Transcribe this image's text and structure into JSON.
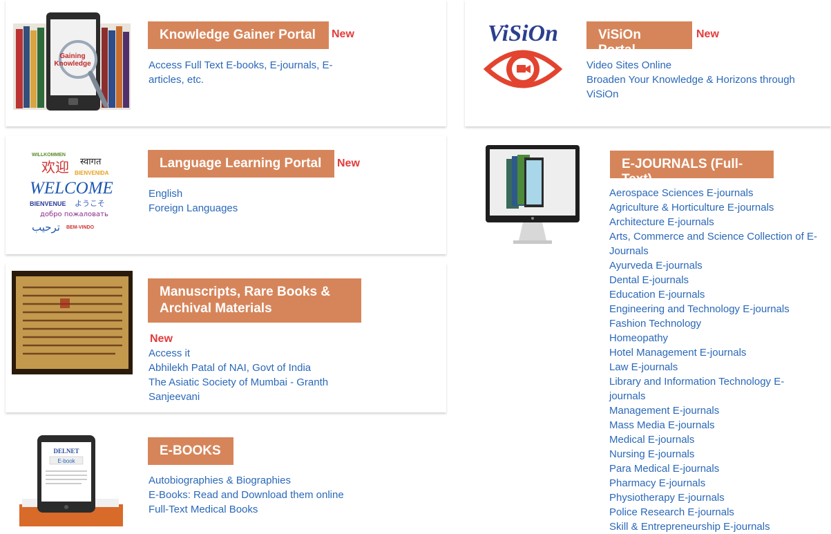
{
  "cards": {
    "knowledge": {
      "title": "Knowledge Gainer Portal",
      "new": "New",
      "thumb_text": [
        "Gaining",
        "Knowledge"
      ],
      "links": [
        "Access Full Text E-books, E-journals, E-articles, etc."
      ]
    },
    "vision": {
      "title": "ViSiOn Portal",
      "new": "New",
      "logo_text": "ViSiOn",
      "links": [
        "Video Sites Online",
        "Broaden Your Knowledge & Horizons through ViSiOn"
      ]
    },
    "language": {
      "title": "Language Learning Portal",
      "new": "New",
      "thumb_words": [
        "WILLKOMMEN",
        "स्वागत",
        "欢迎",
        "BIENVENIDA",
        "WELCOME",
        "BIENVENUE",
        "ようこそ",
        "добро пожаловать",
        "ترحيب",
        "BEM-VINDO"
      ],
      "links": [
        "English",
        "Foreign Languages"
      ]
    },
    "manuscripts": {
      "title": "Manuscripts, Rare Books & Archival Materials",
      "new": "New",
      "links": [
        "Access it",
        "Abhilekh Patal of NAI, Govt of India",
        "The Asiatic Society of Mumbai - Granth Sanjeevani"
      ]
    },
    "ebooks": {
      "title": "E-BOOKS",
      "thumb_brand": "DELNET",
      "thumb_label": "E-book",
      "links": [
        "Autobiographies & Biographies",
        "E-Books: Read and Download them online",
        "Full-Text Medical Books"
      ]
    },
    "ejournals": {
      "title": "E-JOURNALS (Full-Text)",
      "links": [
        "Aerospace Sciences E-journals",
        "Agriculture & Horticulture E-journals",
        "Architecture E-journals",
        "Arts, Commerce and Science Collection of E-Journals",
        "Ayurveda E-journals",
        "Dental E-journals",
        "Education E-journals",
        "Engineering and Technology E-journals",
        "Fashion Technology",
        "Homeopathy",
        "Hotel Management E-journals",
        "Law E-journals",
        "Library and Information Technology E-journals",
        "Management E-journals",
        "Mass Media E-journals",
        "Medical E-journals",
        "Nursing E-journals",
        "Para Medical E-journals",
        "Pharmacy E-journals",
        "Physiotherapy E-journals",
        "Police Research E-journals",
        "Skill & Entrepreneurship E-journals"
      ]
    }
  },
  "colors": {
    "badge": "#d6855a",
    "new": "#e33b3b",
    "link": "#2a68b8"
  }
}
